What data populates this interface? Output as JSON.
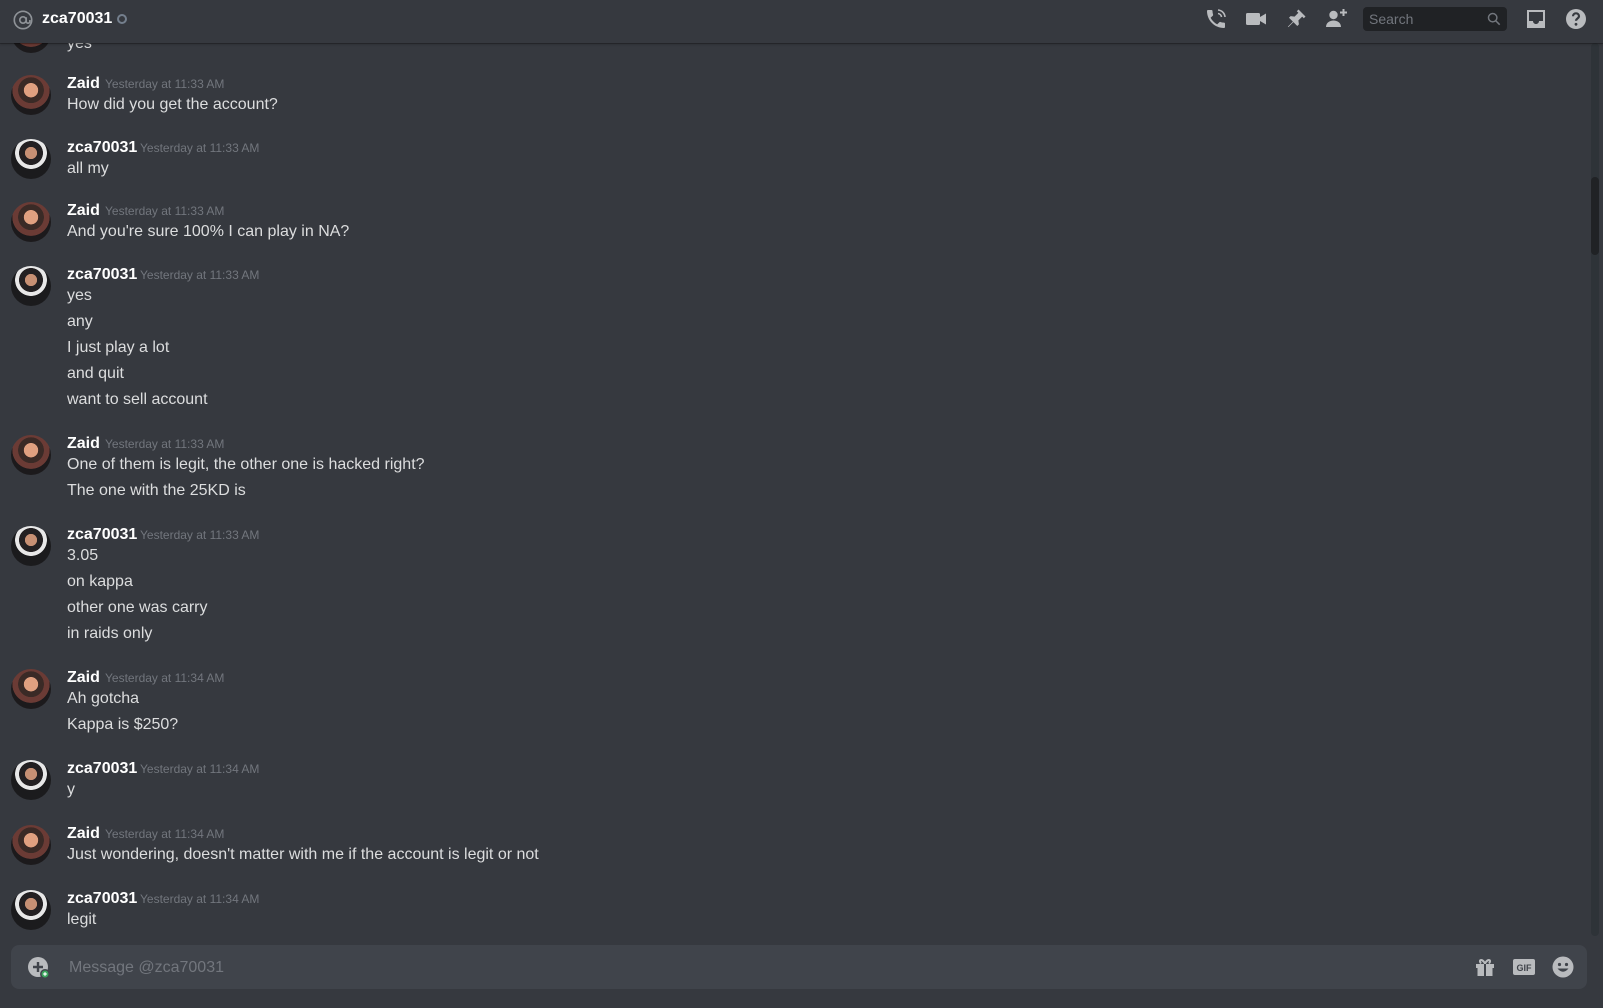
{
  "header": {
    "channel_name": "zca70031",
    "search_placeholder": "Search",
    "icons": [
      "at-icon",
      "status-offline-icon",
      "voice-call-icon",
      "video-call-icon",
      "pin-icon",
      "add-friend-icon",
      "search-icon",
      "inbox-icon",
      "help-icon"
    ]
  },
  "messages": [
    {
      "author": "",
      "timestamp": "",
      "lines": [
        "yes"
      ],
      "partial": true
    },
    {
      "author": "Zaid",
      "timestamp": "Yesterday at 11:33 AM",
      "lines": [
        "How did you get the account?"
      ]
    },
    {
      "author": "zca70031",
      "timestamp": "Yesterday at 11:33 AM",
      "lines": [
        "all my"
      ]
    },
    {
      "author": "Zaid",
      "timestamp": "Yesterday at 11:33 AM",
      "lines": [
        "And you're sure 100% I can play in NA?"
      ]
    },
    {
      "author": "zca70031",
      "timestamp": "Yesterday at 11:33 AM",
      "lines": [
        "yes",
        "any",
        "I just play a lot",
        "and quit",
        "want to sell account"
      ]
    },
    {
      "author": "Zaid",
      "timestamp": "Yesterday at 11:33 AM",
      "lines": [
        "One of them is legit, the other one is hacked right?",
        "The one with the 25KD is"
      ]
    },
    {
      "author": "zca70031",
      "timestamp": "Yesterday at 11:33 AM",
      "lines": [
        "3.05",
        "on kappa",
        "other one was carry",
        "in raids only"
      ]
    },
    {
      "author": "Zaid",
      "timestamp": "Yesterday at 11:34 AM",
      "lines": [
        "Ah gotcha",
        "Kappa is $250?"
      ]
    },
    {
      "author": "zca70031",
      "timestamp": "Yesterday at 11:34 AM",
      "lines": [
        "y"
      ]
    },
    {
      "author": "Zaid",
      "timestamp": "Yesterday at 11:34 AM",
      "lines": [
        "Just wondering, doesn't matter with me if the account is legit or not"
      ]
    },
    {
      "author": "zca70031",
      "timestamp": "Yesterday at 11:34 AM",
      "lines": [
        "legit"
      ]
    }
  ],
  "composer": {
    "placeholder": "Message @zca70031",
    "icons": [
      "upload-plus-icon",
      "gift-icon",
      "gif-icon",
      "emoji-icon"
    ]
  },
  "colors": {
    "background": "#36393f",
    "composer_bg": "#40444b",
    "text": "#dcddde",
    "muted": "#72767d",
    "icon": "#b9bbbe",
    "username": "#ffffff"
  }
}
